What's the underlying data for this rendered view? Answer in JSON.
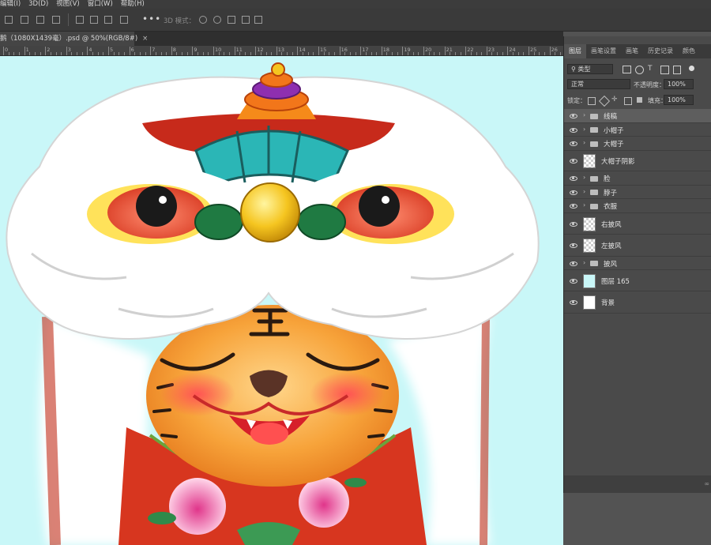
{
  "menu": [
    "编辑(I)",
    "3D(D)",
    "视图(V)",
    "窗口(W)",
    "帮助(H)"
  ],
  "options": {
    "mode_label": "3D 模式：",
    "more": "•••"
  },
  "document": {
    "tab_title": "鹅（1080X1439毫）.psd @ 50%(RGB/8#)",
    "close": "×"
  },
  "ruler": {
    "ticks": [
      "0",
      "1",
      "2",
      "3",
      "4",
      "5",
      "6",
      "7",
      "8",
      "9",
      "10",
      "11",
      "12",
      "13",
      "14",
      "15",
      "16",
      "17",
      "18",
      "19",
      "20",
      "21",
      "22",
      "23",
      "24",
      "25",
      "26"
    ]
  },
  "layers_panel": {
    "tabs": [
      "图层",
      "画笔设置",
      "画笔",
      "历史记录",
      "颜色"
    ],
    "filter": "类型",
    "blend_mode": "正常",
    "opacity_label": "不透明度：",
    "opacity_value": "100%",
    "lock_label": "锁定：",
    "fill_label": "填充：",
    "fill_value": "100%",
    "layers": [
      {
        "name": "线稿",
        "kind": "group",
        "selected": true
      },
      {
        "name": "小帽子",
        "kind": "group"
      },
      {
        "name": "大帽子",
        "kind": "group"
      },
      {
        "name": "大帽子阴影",
        "kind": "layer",
        "thumb": "transparent"
      },
      {
        "name": "脸",
        "kind": "group"
      },
      {
        "name": "脖子",
        "kind": "group"
      },
      {
        "name": "衣服",
        "kind": "group"
      },
      {
        "name": "右披风",
        "kind": "layer",
        "thumb": "transparent"
      },
      {
        "name": "左披风",
        "kind": "layer",
        "thumb": "transparent"
      },
      {
        "name": "披风",
        "kind": "group"
      },
      {
        "name": "图层 165",
        "kind": "layer",
        "thumb": "#c9f7f8"
      },
      {
        "name": "背景",
        "kind": "layer",
        "thumb": "#ffffff"
      }
    ],
    "footer": "∞"
  },
  "colors": {
    "canvas_bg": "#c9f7f8",
    "panel_bg": "#4a4a4a",
    "app_bg": "#535353"
  }
}
